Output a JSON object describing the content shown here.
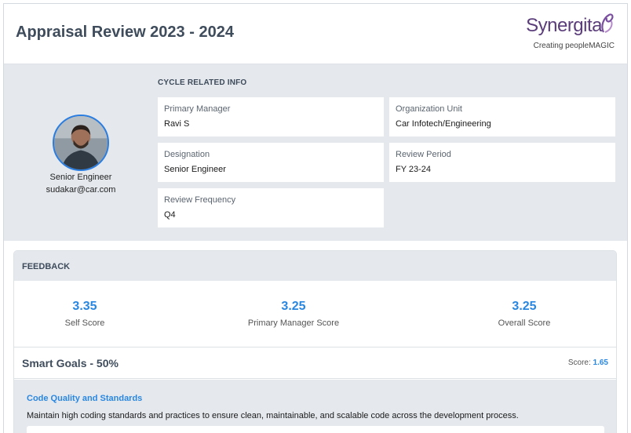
{
  "header": {
    "title": "Appraisal Review 2023 - 2024",
    "logo_word": "Synergita",
    "logo_tagline": "Creating peopleMAGIC"
  },
  "profile": {
    "role": "Senior Engineer",
    "email": "sudakar@car.com"
  },
  "cycle": {
    "section_title": "CYCLE RELATED INFO",
    "fields": [
      {
        "label": "Primary Manager",
        "value": "Ravi S"
      },
      {
        "label": "Organization Unit",
        "value": "Car Infotech/Engineering"
      },
      {
        "label": "Designation",
        "value": "Senior Engineer"
      },
      {
        "label": "Review Period",
        "value": "FY 23-24"
      },
      {
        "label": "Review Frequency",
        "value": "Q4"
      }
    ]
  },
  "feedback": {
    "section_title": "FEEDBACK",
    "scores": [
      {
        "value": "3.35",
        "label": "Self Score"
      },
      {
        "value": "3.25",
        "label": "Primary Manager Score"
      },
      {
        "value": "3.25",
        "label": "Overall Score"
      }
    ]
  },
  "goals": {
    "title": "Smart Goals - 50%",
    "score_label": "Score:",
    "score_value": "1.65",
    "items": [
      {
        "name": "Code Quality and Standards",
        "description": "Maintain high coding standards and practices to ensure clean, maintainable, and scalable code across the development process."
      }
    ]
  },
  "colors": {
    "accent": "#2a87e0",
    "panel_bg": "#e5e9ee",
    "title_text": "#3f4c5c"
  }
}
